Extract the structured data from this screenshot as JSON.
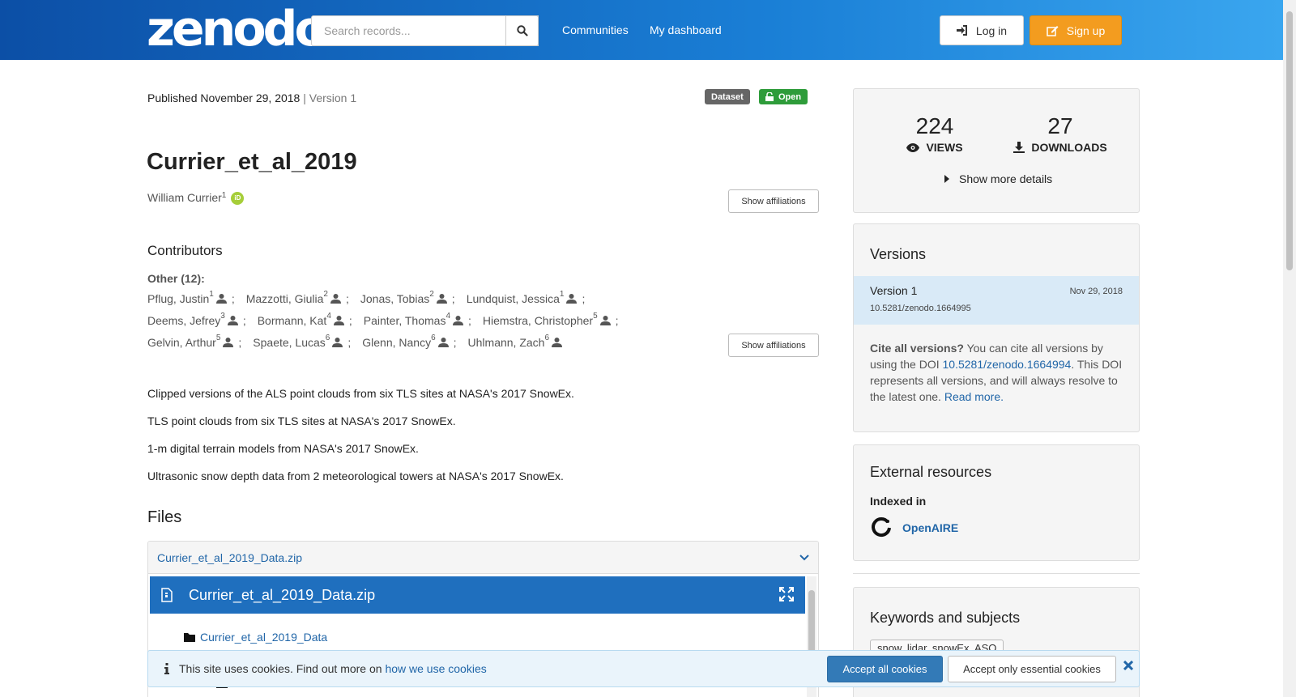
{
  "header": {
    "logo": "zenodo",
    "search_placeholder": "Search records...",
    "nav": [
      "Communities",
      "My dashboard"
    ],
    "login_label": "Log in",
    "signup_label": "Sign up"
  },
  "record": {
    "published": "Published November 29, 2018",
    "version": "Version 1",
    "type_badge": "Dataset",
    "access_badge": "Open",
    "title": "Currier_et_al_2019",
    "creator": "William Currier",
    "creator_aff": "1",
    "show_affiliations": "Show affiliations",
    "contributors_heading": "Contributors",
    "other_label": "Other (12):",
    "contributors": [
      {
        "name": "Pflug, Justin",
        "aff": "1"
      },
      {
        "name": "Mazzotti, Giulia",
        "aff": "2"
      },
      {
        "name": "Jonas, Tobias",
        "aff": "2"
      },
      {
        "name": "Lundquist, Jessica",
        "aff": "1"
      },
      {
        "name": "Deems, Jefrey",
        "aff": "3"
      },
      {
        "name": "Bormann, Kat",
        "aff": "4"
      },
      {
        "name": "Painter, Thomas",
        "aff": "4"
      },
      {
        "name": "Hiemstra, Christopher",
        "aff": "5"
      },
      {
        "name": "Gelvin, Arthur",
        "aff": "5"
      },
      {
        "name": "Spaete, Lucas",
        "aff": "6"
      },
      {
        "name": "Glenn, Nancy",
        "aff": "6"
      },
      {
        "name": "Uhlmann, Zach",
        "aff": "6"
      }
    ],
    "description": [
      "Clipped versions of the ALS point clouds from six TLS sites at NASA's 2017 SnowEx.",
      "TLS point clouds from six TLS sites at NASA's 2017 SnowEx.",
      "1-m digital terrain models from NASA's 2017 SnowEx.",
      "Ultrasonic snow depth data from 2 meteorological towers at NASA's 2017 SnowEx."
    ],
    "files_heading": "Files",
    "file_name": "Currier_et_al_2019_Data.zip",
    "tree_folder": "Currier_et_al_2019_Data",
    "tree_subfolder": "ASO"
  },
  "stats": {
    "views": "224",
    "views_label": "VIEWS",
    "downloads": "27",
    "downloads_label": "DOWNLOADS",
    "more_details": "Show more details"
  },
  "versions": {
    "heading": "Versions",
    "entry_label": "Version 1",
    "entry_date": "Nov 29, 2018",
    "entry_doi": "10.5281/zenodo.1664995",
    "cite_bold": "Cite all versions?",
    "cite_text1": " You can cite all versions by using the DOI ",
    "cite_doi": "10.5281/zenodo.1664994",
    "cite_text2": ". This DOI represents all versions, and will always resolve to the latest one. ",
    "read_more": "Read more."
  },
  "external": {
    "heading": "External resources",
    "indexed_in": "Indexed in",
    "openaire": "OpenAIRE"
  },
  "keywords": {
    "heading": "Keywords and subjects",
    "tag": "snow, lidar, snowEx, ASO"
  },
  "cookie": {
    "text": "This site uses cookies. Find out more on ",
    "link": "how we use cookies",
    "accept_all": "Accept all cookies",
    "accept_essential": "Accept only essential cookies"
  },
  "colors": {
    "brand": "#1a7fd6",
    "signup": "#f39c1f",
    "open_badge": "#2e9c3a",
    "dataset_badge": "#666666"
  }
}
